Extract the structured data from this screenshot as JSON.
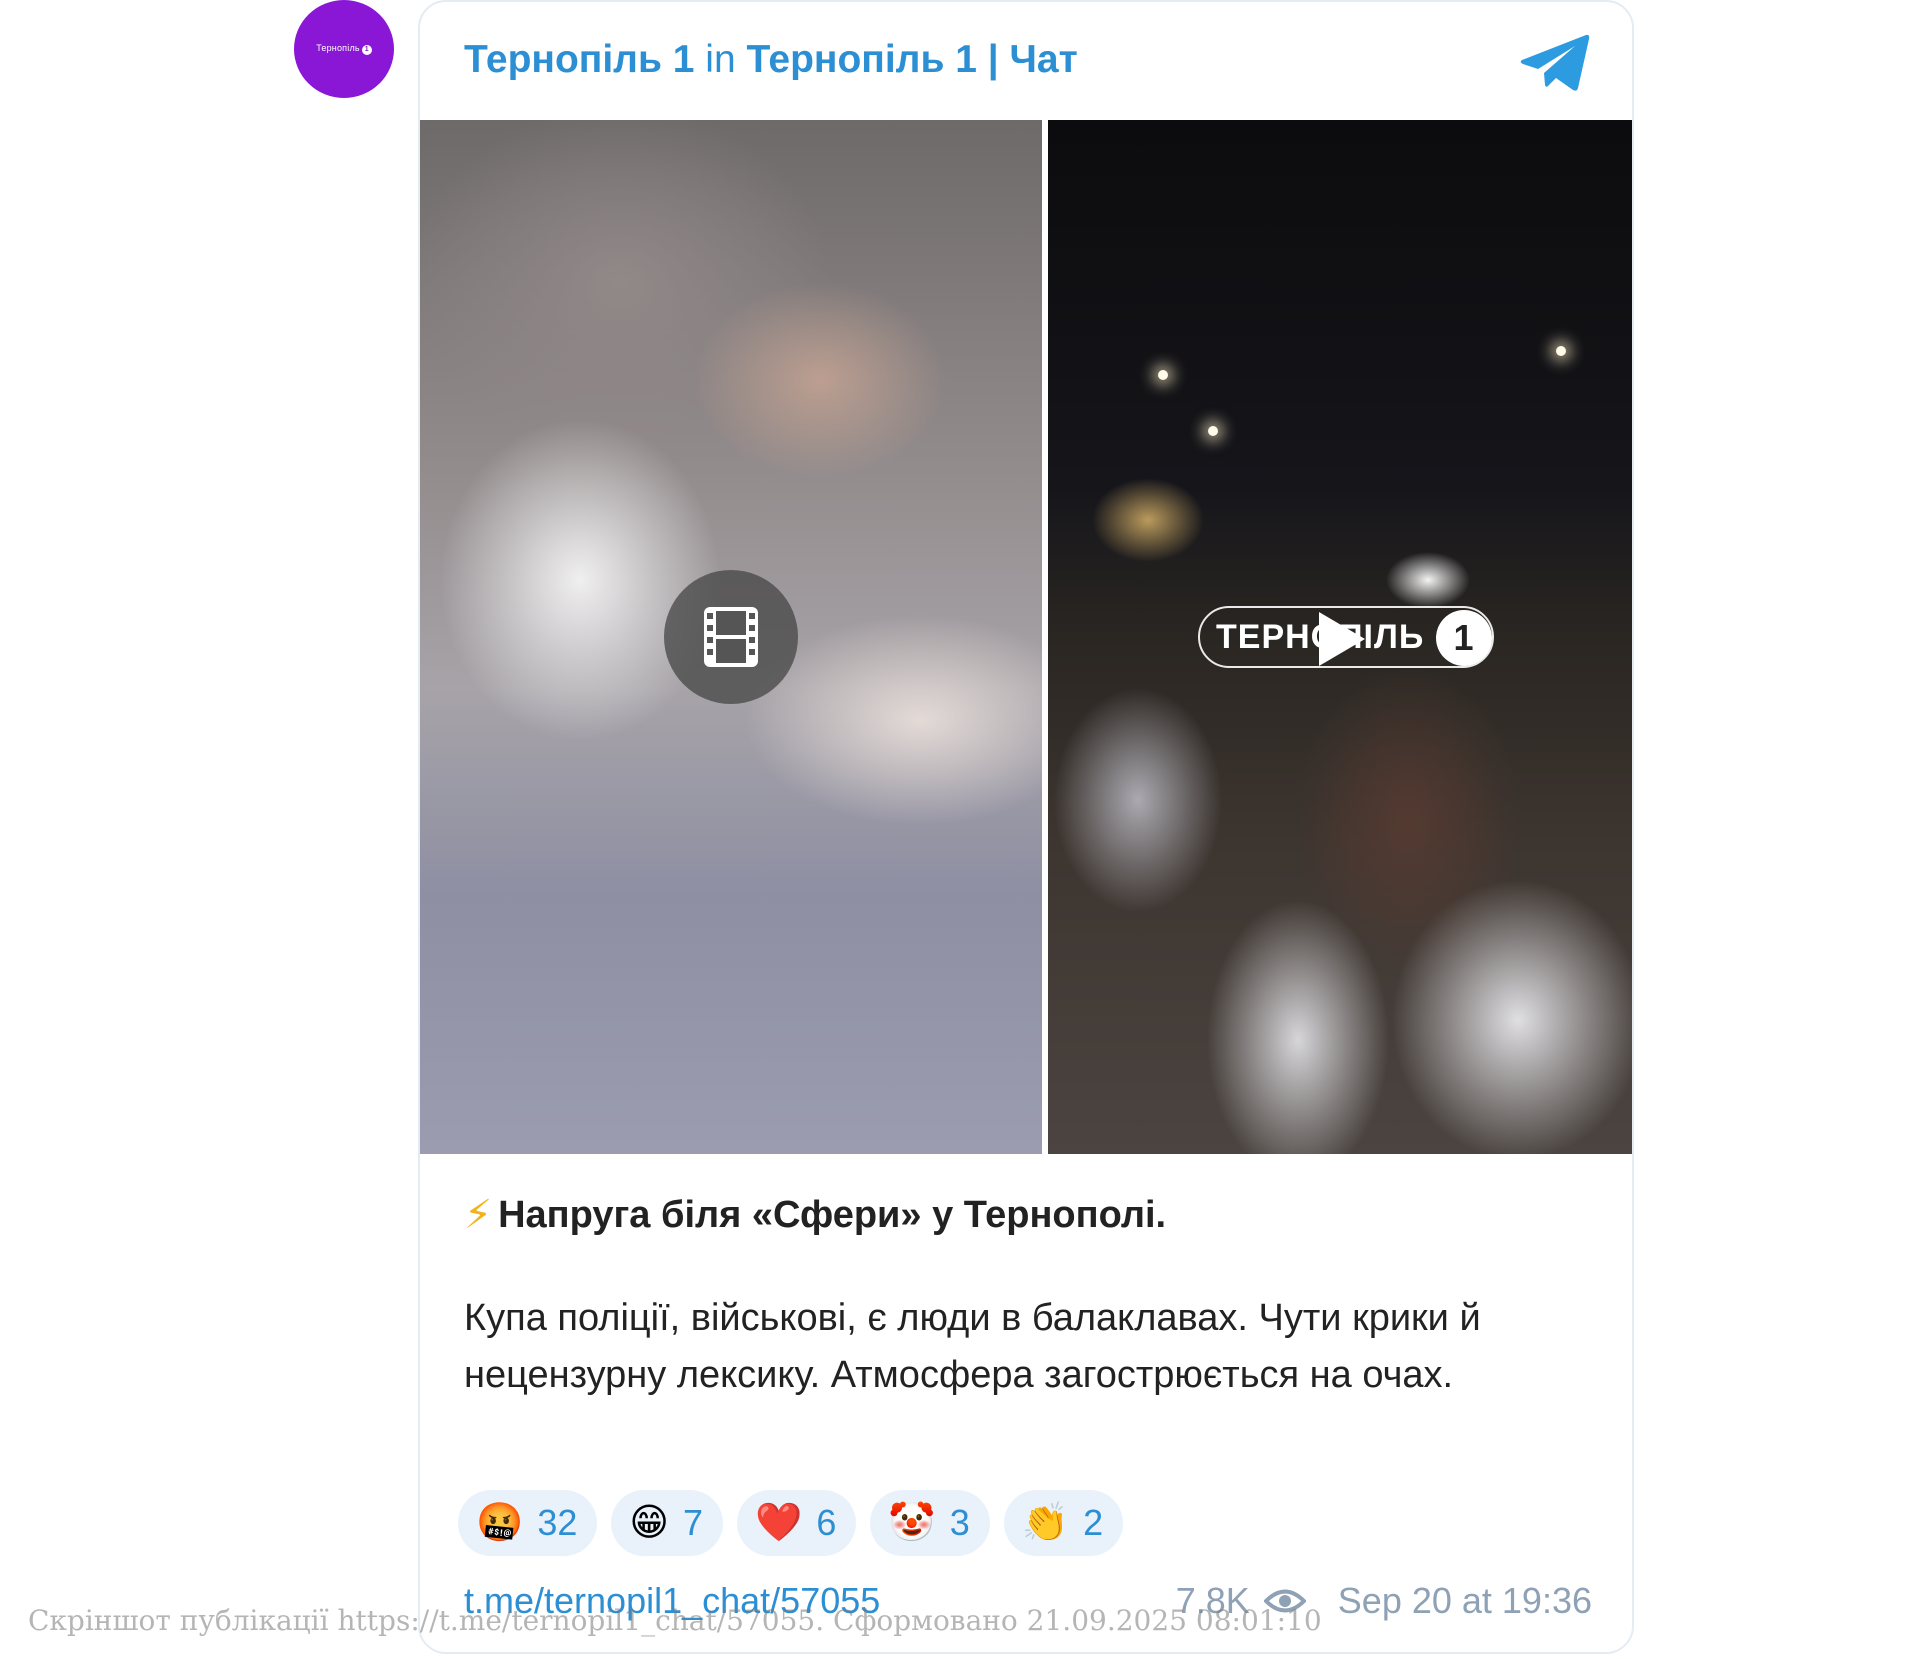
{
  "channel": {
    "avatar_label": "Тернопіль",
    "avatar_badge": "1",
    "name": "Тернопіль 1",
    "in_word": "in",
    "chat_name": "Тернопіль 1 | Чат"
  },
  "media": {
    "watermark": "ТЕРНОПІЛЬ",
    "watermark_badge": "1"
  },
  "post": {
    "title_emoji": "⚡",
    "title": "Напруга біля «Сфери» у Тернополі.",
    "body": "Купа поліції, військові, є люди в балаклавах. Чути крики й нецензурну лексику. Атмосфера загострюється на очах."
  },
  "reactions": [
    {
      "emoji": "🤬",
      "count": "32"
    },
    {
      "emoji": "😁",
      "count": "7"
    },
    {
      "emoji": "❤️",
      "count": "6"
    },
    {
      "emoji": "🤡",
      "count": "3"
    },
    {
      "emoji": "👏",
      "count": "2"
    }
  ],
  "footer": {
    "link": "t.me/ternopil1_chat/57055",
    "views": "7.8K",
    "date": "Sep 20 at 19:36"
  },
  "caption": "Скріншот публікації https://t.me/ternopil1_chat/57055. Сформовано 21.09.2025 08:01:10",
  "colors": {
    "accent": "#2d8fd3",
    "avatar_bg": "#8a17d6",
    "reaction_bg": "#e9f2fb"
  }
}
